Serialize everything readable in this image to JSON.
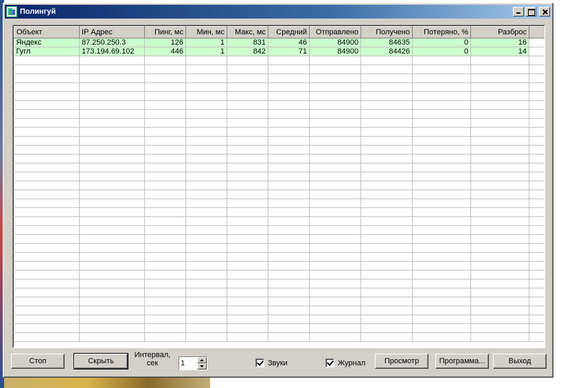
{
  "window": {
    "title": "Полингуй"
  },
  "grid": {
    "columns": [
      "Объект",
      "IP Адрес",
      "Пинг, мс",
      "Мин, мс",
      "Макс, мс",
      "Средний",
      "Отправлено",
      "Получено",
      "Потеряно, %",
      "Разброс"
    ],
    "rows": [
      [
        "Яндекс",
        "87.250.250.3",
        "126",
        "1",
        "831",
        "46",
        "84900",
        "84635",
        "0",
        "16"
      ],
      [
        "Гугл",
        "173.194.69.102",
        "446",
        "1",
        "842",
        "71",
        "84900",
        "84426",
        "0",
        "14"
      ]
    ],
    "row_color": "#ccffcc"
  },
  "buttons": {
    "stop": "Стоп",
    "hide": "Скрыть",
    "view": "Просмотр",
    "program": "Программа...",
    "exit": "Выход"
  },
  "interval": {
    "label": "Интервал, сек",
    "value": "1"
  },
  "checkboxes": {
    "sounds": {
      "label": "Звуки",
      "checked": true
    },
    "log": {
      "label": "Журнал",
      "checked": true
    }
  },
  "colors": {
    "titlebar": "#0a246a",
    "face": "#d4d0c8"
  }
}
